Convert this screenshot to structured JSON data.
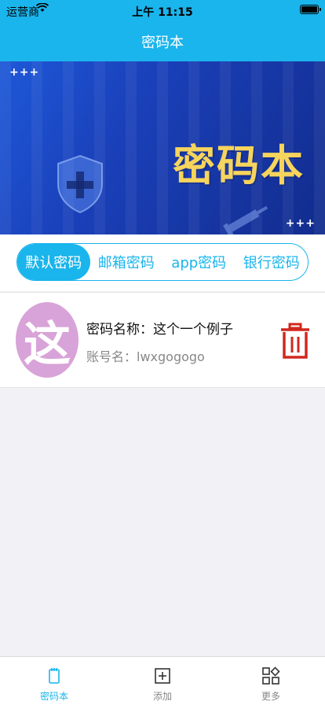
{
  "status_bar": {
    "carrier": "运营商",
    "time": "上午 11:15"
  },
  "nav": {
    "title": "密码本"
  },
  "banner": {
    "brand_text": "密码本",
    "plus_tl": "+++",
    "plus_br": "+++"
  },
  "tabs": [
    {
      "label": "默认密码",
      "active": true
    },
    {
      "label": "邮箱密码",
      "active": false
    },
    {
      "label": "app密码",
      "active": false
    },
    {
      "label": "银行密码",
      "active": false
    }
  ],
  "entries": [
    {
      "avatar_char": "这",
      "name": "密码名称：这个一个例子",
      "account": "账号名：lwxgogogo"
    }
  ],
  "tabbar": [
    {
      "label": "密码本",
      "icon": "notebook-icon",
      "active": true
    },
    {
      "label": "添加",
      "icon": "add-square-icon",
      "active": false
    },
    {
      "label": "更多",
      "icon": "grid-more-icon",
      "active": false
    }
  ],
  "colors": {
    "accent": "#1ab5ec",
    "delete": "#d0281e",
    "avatar_bg": "#d8a3d8",
    "brand_text": "#f7d45c"
  }
}
